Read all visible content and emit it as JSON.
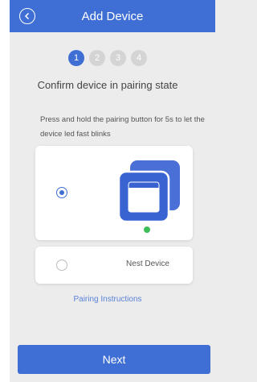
{
  "header": {
    "title": "Add Device",
    "back_icon": "chevron-left-icon"
  },
  "steps": [
    "1",
    "2",
    "3",
    "4"
  ],
  "active_step": 1,
  "subtitle": "Confirm device in pairing state",
  "instruction": "Press and hold the pairing button for 5s to let the device led fast blinks",
  "options": [
    {
      "label": "",
      "selected": true,
      "icon": "device-icon"
    },
    {
      "label": "Nest Device",
      "selected": false
    }
  ],
  "pairing_link": "Pairing Instructions",
  "next_button": "Next",
  "colors": {
    "accent": "#3f6fd4",
    "led": "#3fbf5a"
  }
}
